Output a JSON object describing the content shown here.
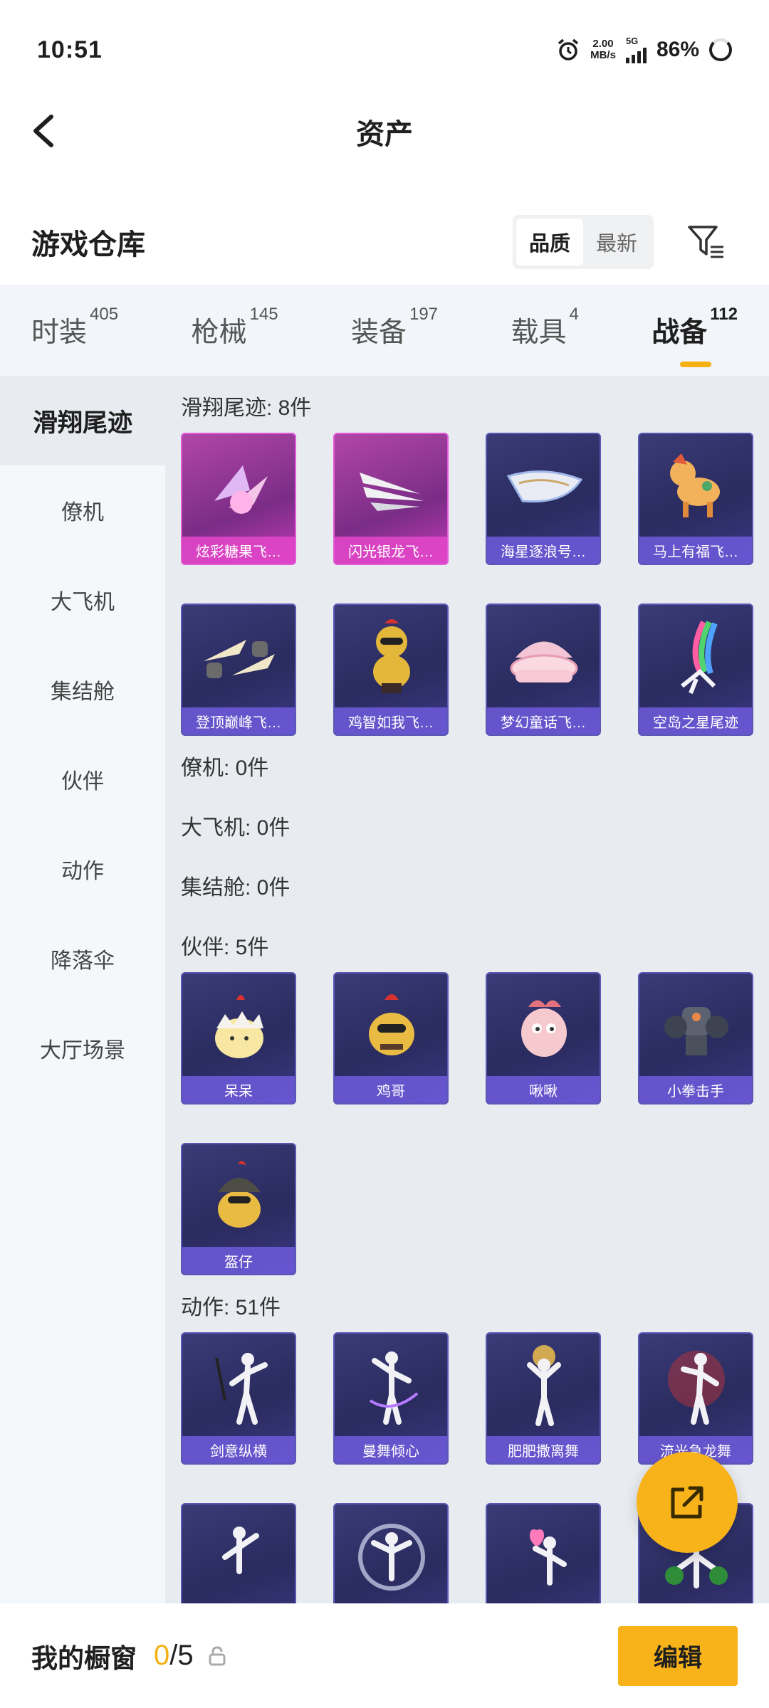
{
  "status_bar": {
    "time": "10:51",
    "net_speed_value": "2.00",
    "net_speed_unit": "MB/s",
    "network": "5G",
    "battery": "86%"
  },
  "nav": {
    "title": "资产"
  },
  "header": {
    "title": "游戏仓库",
    "sort_options": [
      "品质",
      "最新"
    ],
    "active_sort": "品质"
  },
  "tabs": [
    {
      "label": "时装",
      "count": "405"
    },
    {
      "label": "枪械",
      "count": "145"
    },
    {
      "label": "装备",
      "count": "197"
    },
    {
      "label": "载具",
      "count": "4"
    },
    {
      "label": "战备",
      "count": "112"
    }
  ],
  "sidebar": [
    "滑翔尾迹",
    "僚机",
    "大飞机",
    "集结舱",
    "伙伴",
    "动作",
    "降落伞",
    "大厅场景"
  ],
  "sections": {
    "glide": {
      "title": "滑翔尾迹: 8件",
      "items": [
        "炫彩糖果飞…",
        "闪光银龙飞…",
        "海星逐浪号…",
        "马上有福飞…",
        "登顶巅峰飞…",
        "鸡智如我飞…",
        "梦幻童话飞…",
        "空岛之星尾迹"
      ]
    },
    "wingman": {
      "title": "僚机: 0件"
    },
    "plane": {
      "title": "大飞机: 0件"
    },
    "capsule": {
      "title": "集结舱: 0件"
    },
    "partner": {
      "title": "伙伴: 5件",
      "items": [
        "呆呆",
        "鸡哥",
        "啾啾",
        "小拳击手",
        "盔仔"
      ]
    },
    "emote": {
      "title": "动作: 51件",
      "items": [
        "剑意纵横",
        "曼舞倾心",
        "肥肥撒离舞",
        "流光急龙舞"
      ]
    }
  },
  "bottom_bar": {
    "title": "我的橱窗",
    "current": "0",
    "total": "/5",
    "edit_label": "编辑"
  },
  "colors": {
    "accent": "#f7b319",
    "card_purple": "#3a3b78",
    "card_pink": "#b246a8"
  }
}
